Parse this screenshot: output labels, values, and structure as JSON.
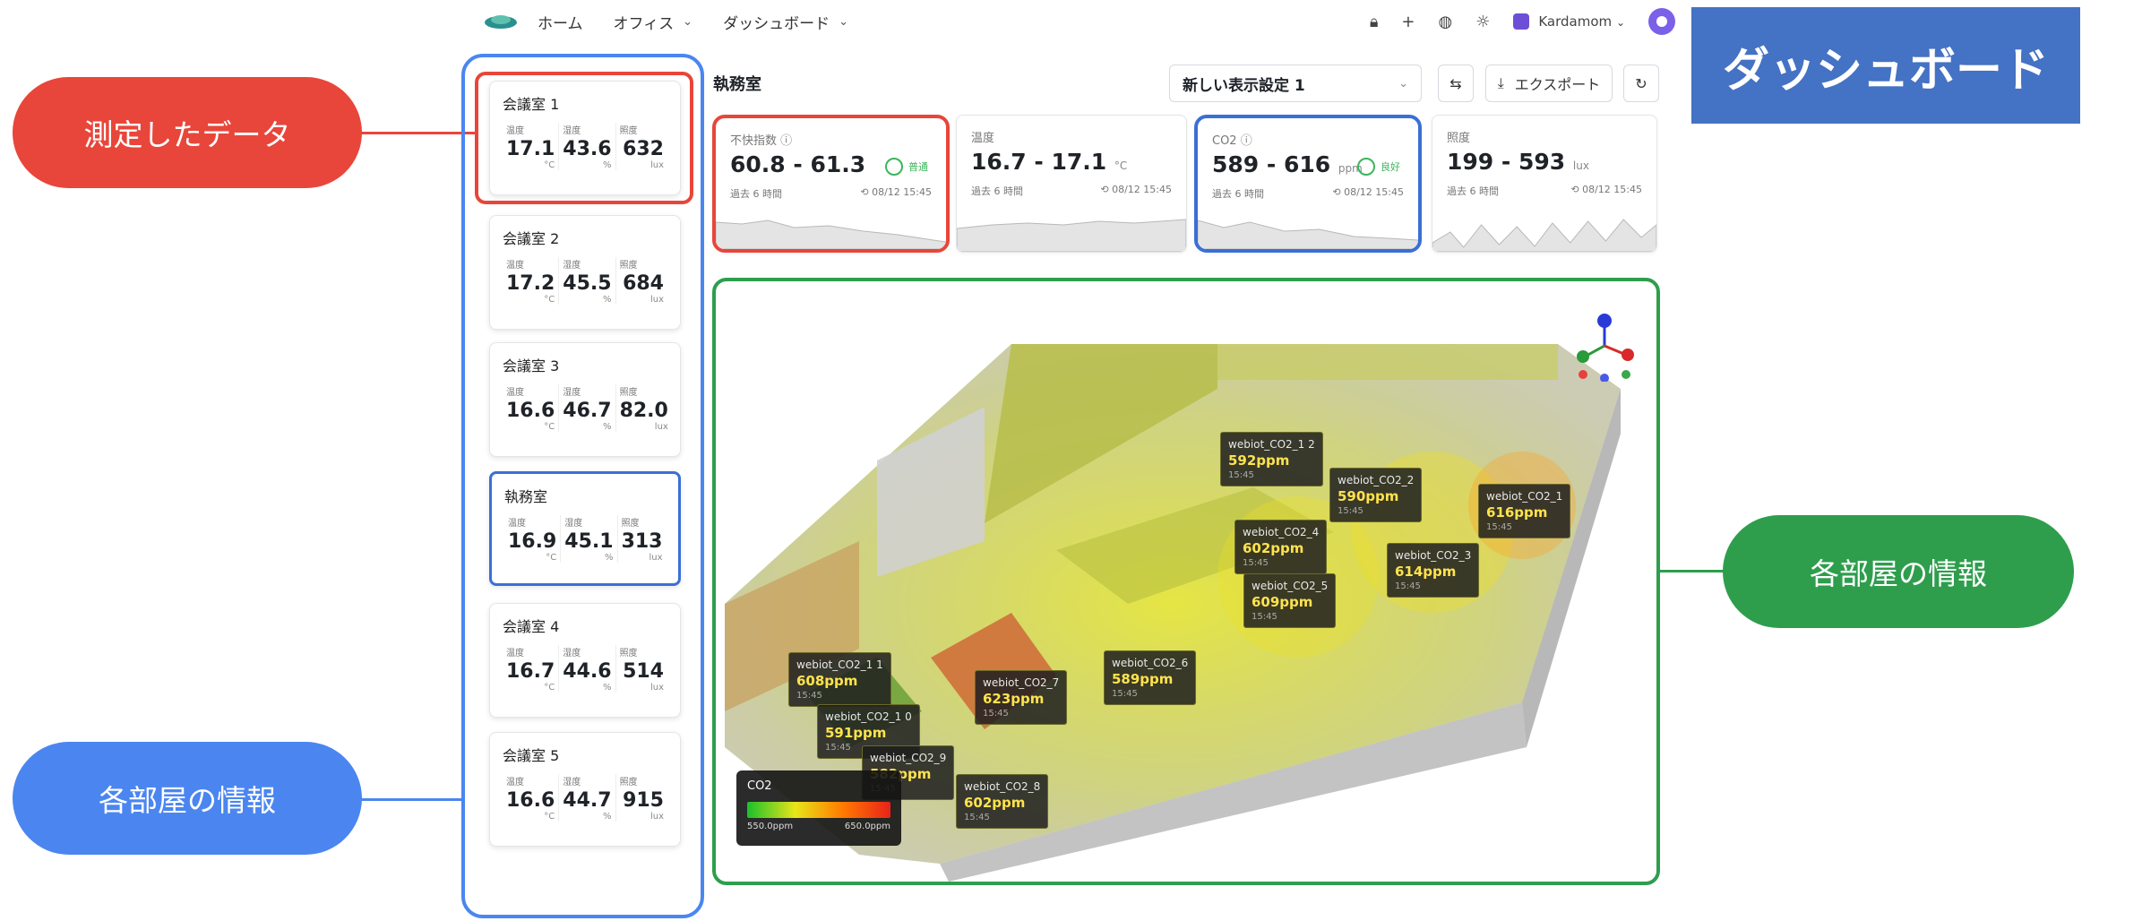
{
  "nav": {
    "home": "ホーム",
    "office": "オフィス",
    "dashboard": "ダッシュボード",
    "user": "Kardamom"
  },
  "badge": "ダッシュボード",
  "callouts": {
    "measured": "測定したデータ",
    "rooms_left": "各部屋の情報",
    "rooms_right": "各部屋の情報"
  },
  "rooms": [
    {
      "name": "会議室 1",
      "temp": "17.1",
      "hum": "43.6",
      "lux": "632"
    },
    {
      "name": "会議室 2",
      "temp": "17.2",
      "hum": "45.5",
      "lux": "684"
    },
    {
      "name": "会議室 3",
      "temp": "16.6",
      "hum": "46.7",
      "lux": "82.0"
    },
    {
      "name": "執務室",
      "temp": "16.9",
      "hum": "45.1",
      "lux": "313"
    },
    {
      "name": "会議室 4",
      "temp": "16.7",
      "hum": "44.6",
      "lux": "514"
    },
    {
      "name": "会議室 5",
      "temp": "16.6",
      "hum": "44.7",
      "lux": "915"
    }
  ],
  "room_labels": {
    "temp": "温度",
    "hum": "湿度",
    "lux": "照度",
    "temp_unit": "°C",
    "hum_unit": "%",
    "lux_unit": "lux"
  },
  "header": {
    "title": "執務室",
    "view_select": "新しい表示設定 1",
    "export": "エクスポート"
  },
  "metrics": [
    {
      "label": "不快指数",
      "value": "60.8 - 61.3",
      "unit": "",
      "status": "普通",
      "period": "過去 6 時間",
      "time": "08/12 15:45"
    },
    {
      "label": "温度",
      "value": "16.7 - 17.1",
      "unit": "°C",
      "status": "",
      "period": "過去 6 時間",
      "time": "08/12 15:45"
    },
    {
      "label": "CO2",
      "value": "589 - 616",
      "unit": "ppm",
      "status": "良好",
      "period": "過去 6 時間",
      "time": "08/12 15:45"
    },
    {
      "label": "照度",
      "value": "199 - 593",
      "unit": "lux",
      "status": "",
      "period": "過去 6 時間",
      "time": "08/12 15:45"
    }
  ],
  "sensors": [
    {
      "name": "webiot_CO2_1 2",
      "value": "592ppm",
      "time": "15:45"
    },
    {
      "name": "webiot_CO2_2",
      "value": "590ppm",
      "time": "15:45"
    },
    {
      "name": "webiot_CO2_1",
      "value": "616ppm",
      "time": "15:45"
    },
    {
      "name": "webiot_CO2_4",
      "value": "602ppm",
      "time": "15:45"
    },
    {
      "name": "webiot_CO2_3",
      "value": "614ppm",
      "time": "15:45"
    },
    {
      "name": "webiot_CO2_5",
      "value": "609ppm",
      "time": "15:45"
    },
    {
      "name": "webiot_CO2_6",
      "value": "589ppm",
      "time": "15:45"
    },
    {
      "name": "webiot_CO2_7",
      "value": "623ppm",
      "time": "15:45"
    },
    {
      "name": "webiot_CO2_1 1",
      "value": "608ppm",
      "time": "15:45"
    },
    {
      "name": "webiot_CO2_1 0",
      "value": "591ppm",
      "time": "15:45"
    },
    {
      "name": "webiot_CO2_9",
      "value": "582ppm",
      "time": "15:45"
    },
    {
      "name": "webiot_CO2_8",
      "value": "602ppm",
      "time": "15:45"
    }
  ],
  "legend": {
    "title": "CO2",
    "min": "550.0ppm",
    "max": "650.0ppm"
  },
  "colors": {
    "red": "#e8463a",
    "blue": "#4b86f0",
    "green": "#2e9e4d",
    "badge": "#4472c4"
  }
}
